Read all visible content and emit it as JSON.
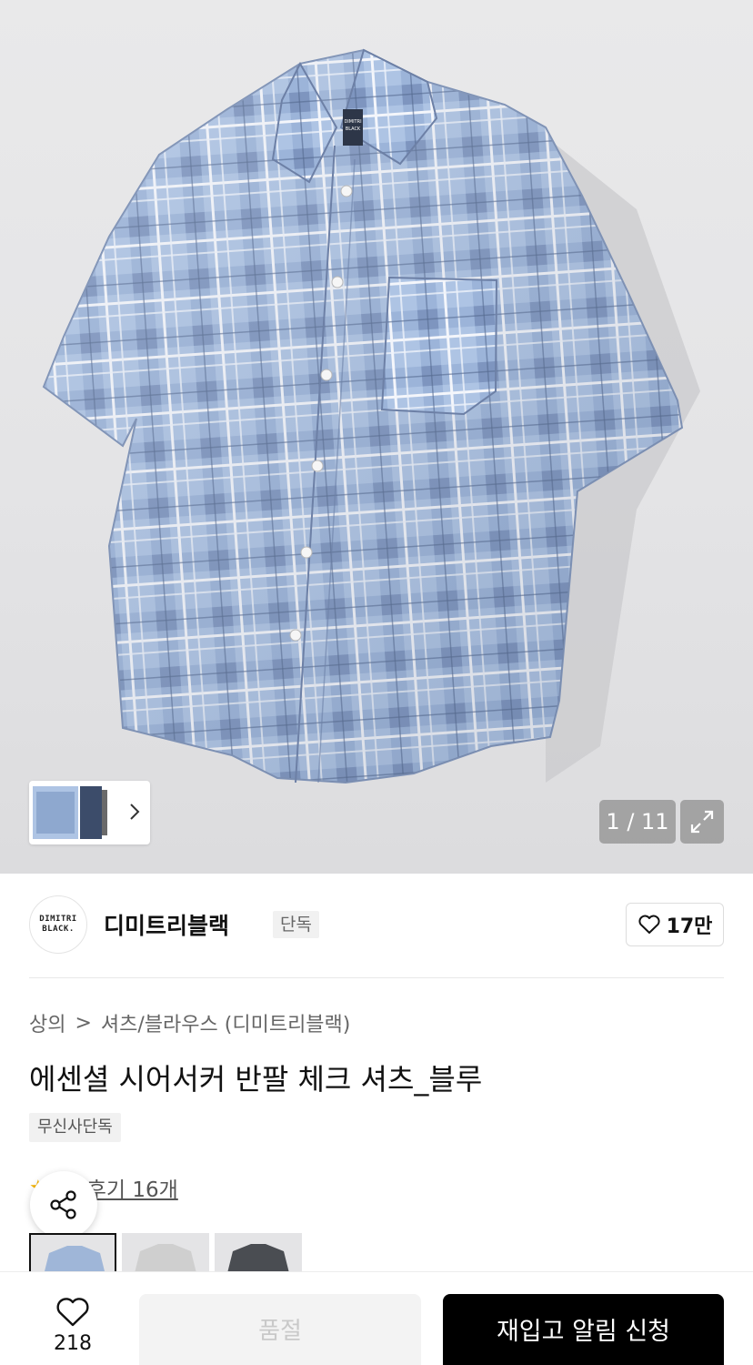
{
  "gallery": {
    "counter": "1 / 11",
    "brand_label_on_shirt": [
      "DIMITRI",
      "BLACK"
    ]
  },
  "brand": {
    "logo_lines": [
      "DIMITRI",
      "BLACK."
    ],
    "name": "디미트리블랙",
    "tag": "단독",
    "likes": "17만"
  },
  "breadcrumb": {
    "items": [
      "상의",
      "셔츠/블라우스 (디미트리블랙)"
    ],
    "separator": ">"
  },
  "product": {
    "title": "에센셜 시어서커 반팔 체크 셔츠_블루",
    "exclusive_badge": "무신사단독",
    "review_link": "후기 16개"
  },
  "bottom_bar": {
    "wish_count": "218",
    "soldout_label": "품절",
    "restock_label": "재입고 알림 신청"
  },
  "colors": {
    "primary_button": "#000000",
    "disabled_button": "#f3f3f3",
    "star": "#f5b400",
    "shirt_blue": "#a9c0e0"
  },
  "icons": [
    "chevron-right-icon",
    "expand-icon",
    "heart-icon",
    "share-icon",
    "star-icon"
  ]
}
